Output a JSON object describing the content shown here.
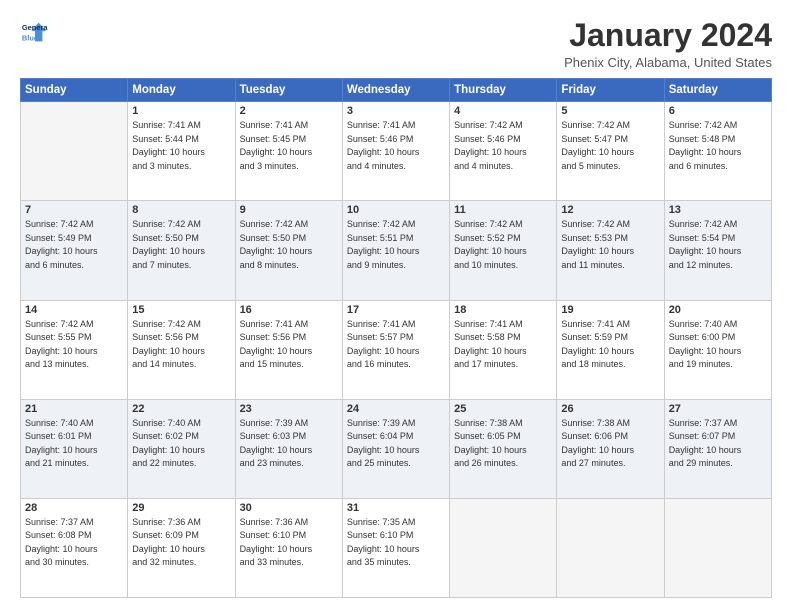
{
  "logo": {
    "line1": "General",
    "line2": "Blue"
  },
  "title": "January 2024",
  "location": "Phenix City, Alabama, United States",
  "days_of_week": [
    "Sunday",
    "Monday",
    "Tuesday",
    "Wednesday",
    "Thursday",
    "Friday",
    "Saturday"
  ],
  "weeks": [
    [
      {
        "day": "",
        "info": ""
      },
      {
        "day": "1",
        "info": "Sunrise: 7:41 AM\nSunset: 5:44 PM\nDaylight: 10 hours\nand 3 minutes."
      },
      {
        "day": "2",
        "info": "Sunrise: 7:41 AM\nSunset: 5:45 PM\nDaylight: 10 hours\nand 3 minutes."
      },
      {
        "day": "3",
        "info": "Sunrise: 7:41 AM\nSunset: 5:46 PM\nDaylight: 10 hours\nand 4 minutes."
      },
      {
        "day": "4",
        "info": "Sunrise: 7:42 AM\nSunset: 5:46 PM\nDaylight: 10 hours\nand 4 minutes."
      },
      {
        "day": "5",
        "info": "Sunrise: 7:42 AM\nSunset: 5:47 PM\nDaylight: 10 hours\nand 5 minutes."
      },
      {
        "day": "6",
        "info": "Sunrise: 7:42 AM\nSunset: 5:48 PM\nDaylight: 10 hours\nand 6 minutes."
      }
    ],
    [
      {
        "day": "7",
        "info": "Sunrise: 7:42 AM\nSunset: 5:49 PM\nDaylight: 10 hours\nand 6 minutes."
      },
      {
        "day": "8",
        "info": "Sunrise: 7:42 AM\nSunset: 5:50 PM\nDaylight: 10 hours\nand 7 minutes."
      },
      {
        "day": "9",
        "info": "Sunrise: 7:42 AM\nSunset: 5:50 PM\nDaylight: 10 hours\nand 8 minutes."
      },
      {
        "day": "10",
        "info": "Sunrise: 7:42 AM\nSunset: 5:51 PM\nDaylight: 10 hours\nand 9 minutes."
      },
      {
        "day": "11",
        "info": "Sunrise: 7:42 AM\nSunset: 5:52 PM\nDaylight: 10 hours\nand 10 minutes."
      },
      {
        "day": "12",
        "info": "Sunrise: 7:42 AM\nSunset: 5:53 PM\nDaylight: 10 hours\nand 11 minutes."
      },
      {
        "day": "13",
        "info": "Sunrise: 7:42 AM\nSunset: 5:54 PM\nDaylight: 10 hours\nand 12 minutes."
      }
    ],
    [
      {
        "day": "14",
        "info": "Sunrise: 7:42 AM\nSunset: 5:55 PM\nDaylight: 10 hours\nand 13 minutes."
      },
      {
        "day": "15",
        "info": "Sunrise: 7:42 AM\nSunset: 5:56 PM\nDaylight: 10 hours\nand 14 minutes."
      },
      {
        "day": "16",
        "info": "Sunrise: 7:41 AM\nSunset: 5:56 PM\nDaylight: 10 hours\nand 15 minutes."
      },
      {
        "day": "17",
        "info": "Sunrise: 7:41 AM\nSunset: 5:57 PM\nDaylight: 10 hours\nand 16 minutes."
      },
      {
        "day": "18",
        "info": "Sunrise: 7:41 AM\nSunset: 5:58 PM\nDaylight: 10 hours\nand 17 minutes."
      },
      {
        "day": "19",
        "info": "Sunrise: 7:41 AM\nSunset: 5:59 PM\nDaylight: 10 hours\nand 18 minutes."
      },
      {
        "day": "20",
        "info": "Sunrise: 7:40 AM\nSunset: 6:00 PM\nDaylight: 10 hours\nand 19 minutes."
      }
    ],
    [
      {
        "day": "21",
        "info": "Sunrise: 7:40 AM\nSunset: 6:01 PM\nDaylight: 10 hours\nand 21 minutes."
      },
      {
        "day": "22",
        "info": "Sunrise: 7:40 AM\nSunset: 6:02 PM\nDaylight: 10 hours\nand 22 minutes."
      },
      {
        "day": "23",
        "info": "Sunrise: 7:39 AM\nSunset: 6:03 PM\nDaylight: 10 hours\nand 23 minutes."
      },
      {
        "day": "24",
        "info": "Sunrise: 7:39 AM\nSunset: 6:04 PM\nDaylight: 10 hours\nand 25 minutes."
      },
      {
        "day": "25",
        "info": "Sunrise: 7:38 AM\nSunset: 6:05 PM\nDaylight: 10 hours\nand 26 minutes."
      },
      {
        "day": "26",
        "info": "Sunrise: 7:38 AM\nSunset: 6:06 PM\nDaylight: 10 hours\nand 27 minutes."
      },
      {
        "day": "27",
        "info": "Sunrise: 7:37 AM\nSunset: 6:07 PM\nDaylight: 10 hours\nand 29 minutes."
      }
    ],
    [
      {
        "day": "28",
        "info": "Sunrise: 7:37 AM\nSunset: 6:08 PM\nDaylight: 10 hours\nand 30 minutes."
      },
      {
        "day": "29",
        "info": "Sunrise: 7:36 AM\nSunset: 6:09 PM\nDaylight: 10 hours\nand 32 minutes."
      },
      {
        "day": "30",
        "info": "Sunrise: 7:36 AM\nSunset: 6:10 PM\nDaylight: 10 hours\nand 33 minutes."
      },
      {
        "day": "31",
        "info": "Sunrise: 7:35 AM\nSunset: 6:10 PM\nDaylight: 10 hours\nand 35 minutes."
      },
      {
        "day": "",
        "info": ""
      },
      {
        "day": "",
        "info": ""
      },
      {
        "day": "",
        "info": ""
      }
    ]
  ]
}
